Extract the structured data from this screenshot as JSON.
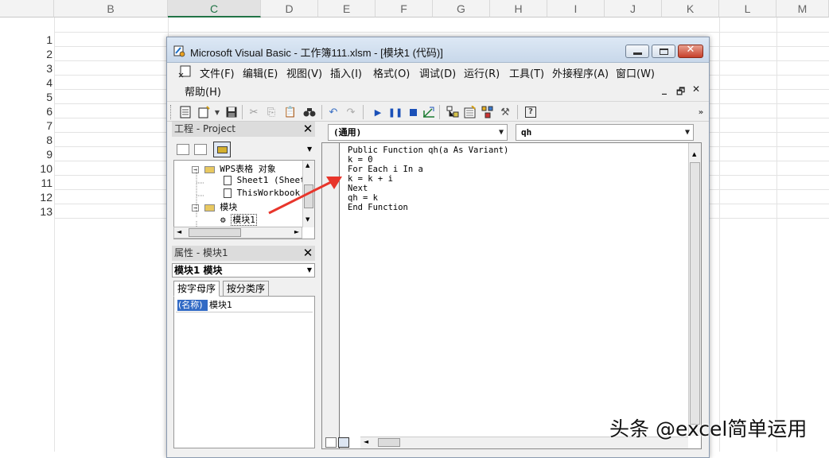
{
  "spreadsheet": {
    "columns": [
      "B",
      "C",
      "D",
      "E",
      "F",
      "G",
      "H",
      "I",
      "J",
      "K",
      "L",
      "M"
    ],
    "active_column": "C",
    "rows": [
      "1",
      "2",
      "3",
      "4",
      "5",
      "6",
      "7",
      "8",
      "9",
      "10",
      "11",
      "12",
      "13"
    ]
  },
  "vbe": {
    "title": "Microsoft Visual Basic - 工作簿111.xlsm - [模块1 (代码)]",
    "menu": {
      "file": "文件(F)",
      "edit": "编辑(E)",
      "view": "视图(V)",
      "insert": "插入(I)",
      "format": "格式(O)",
      "debug": "调试(D)",
      "run": "运行(R)",
      "tools": "工具(T)",
      "addins": "外接程序(A)",
      "window": "窗口(W)",
      "help": "帮助(H)"
    },
    "project": {
      "header": "工程 - Project",
      "tree": {
        "wps_objects": "WPS表格 对象",
        "sheet1": "Sheet1 (Sheet",
        "thisworkbook": "ThisWorkbook",
        "modules": "模块",
        "module1": "模块1"
      }
    },
    "properties": {
      "header": "属性 - 模块1",
      "combo": "模块1 模块",
      "tab_alpha": "按字母序",
      "tab_category": "按分类序",
      "name_key": "(名称)",
      "name_value": "模块1"
    },
    "code": {
      "object_combo": "(通用)",
      "proc_combo": "qh",
      "lines": [
        "Public Function qh(a As Variant)",
        "k = 0",
        "For Each i In a",
        "k = k + i",
        "Next",
        "qh = k",
        "End Function"
      ]
    }
  },
  "watermark": "头条 @excel简单运用",
  "colors": {
    "accent_green": "#217346",
    "title_gradient_top": "#dde8f5",
    "selection_blue": "#316ac5",
    "arrow_red": "#e8352b"
  }
}
